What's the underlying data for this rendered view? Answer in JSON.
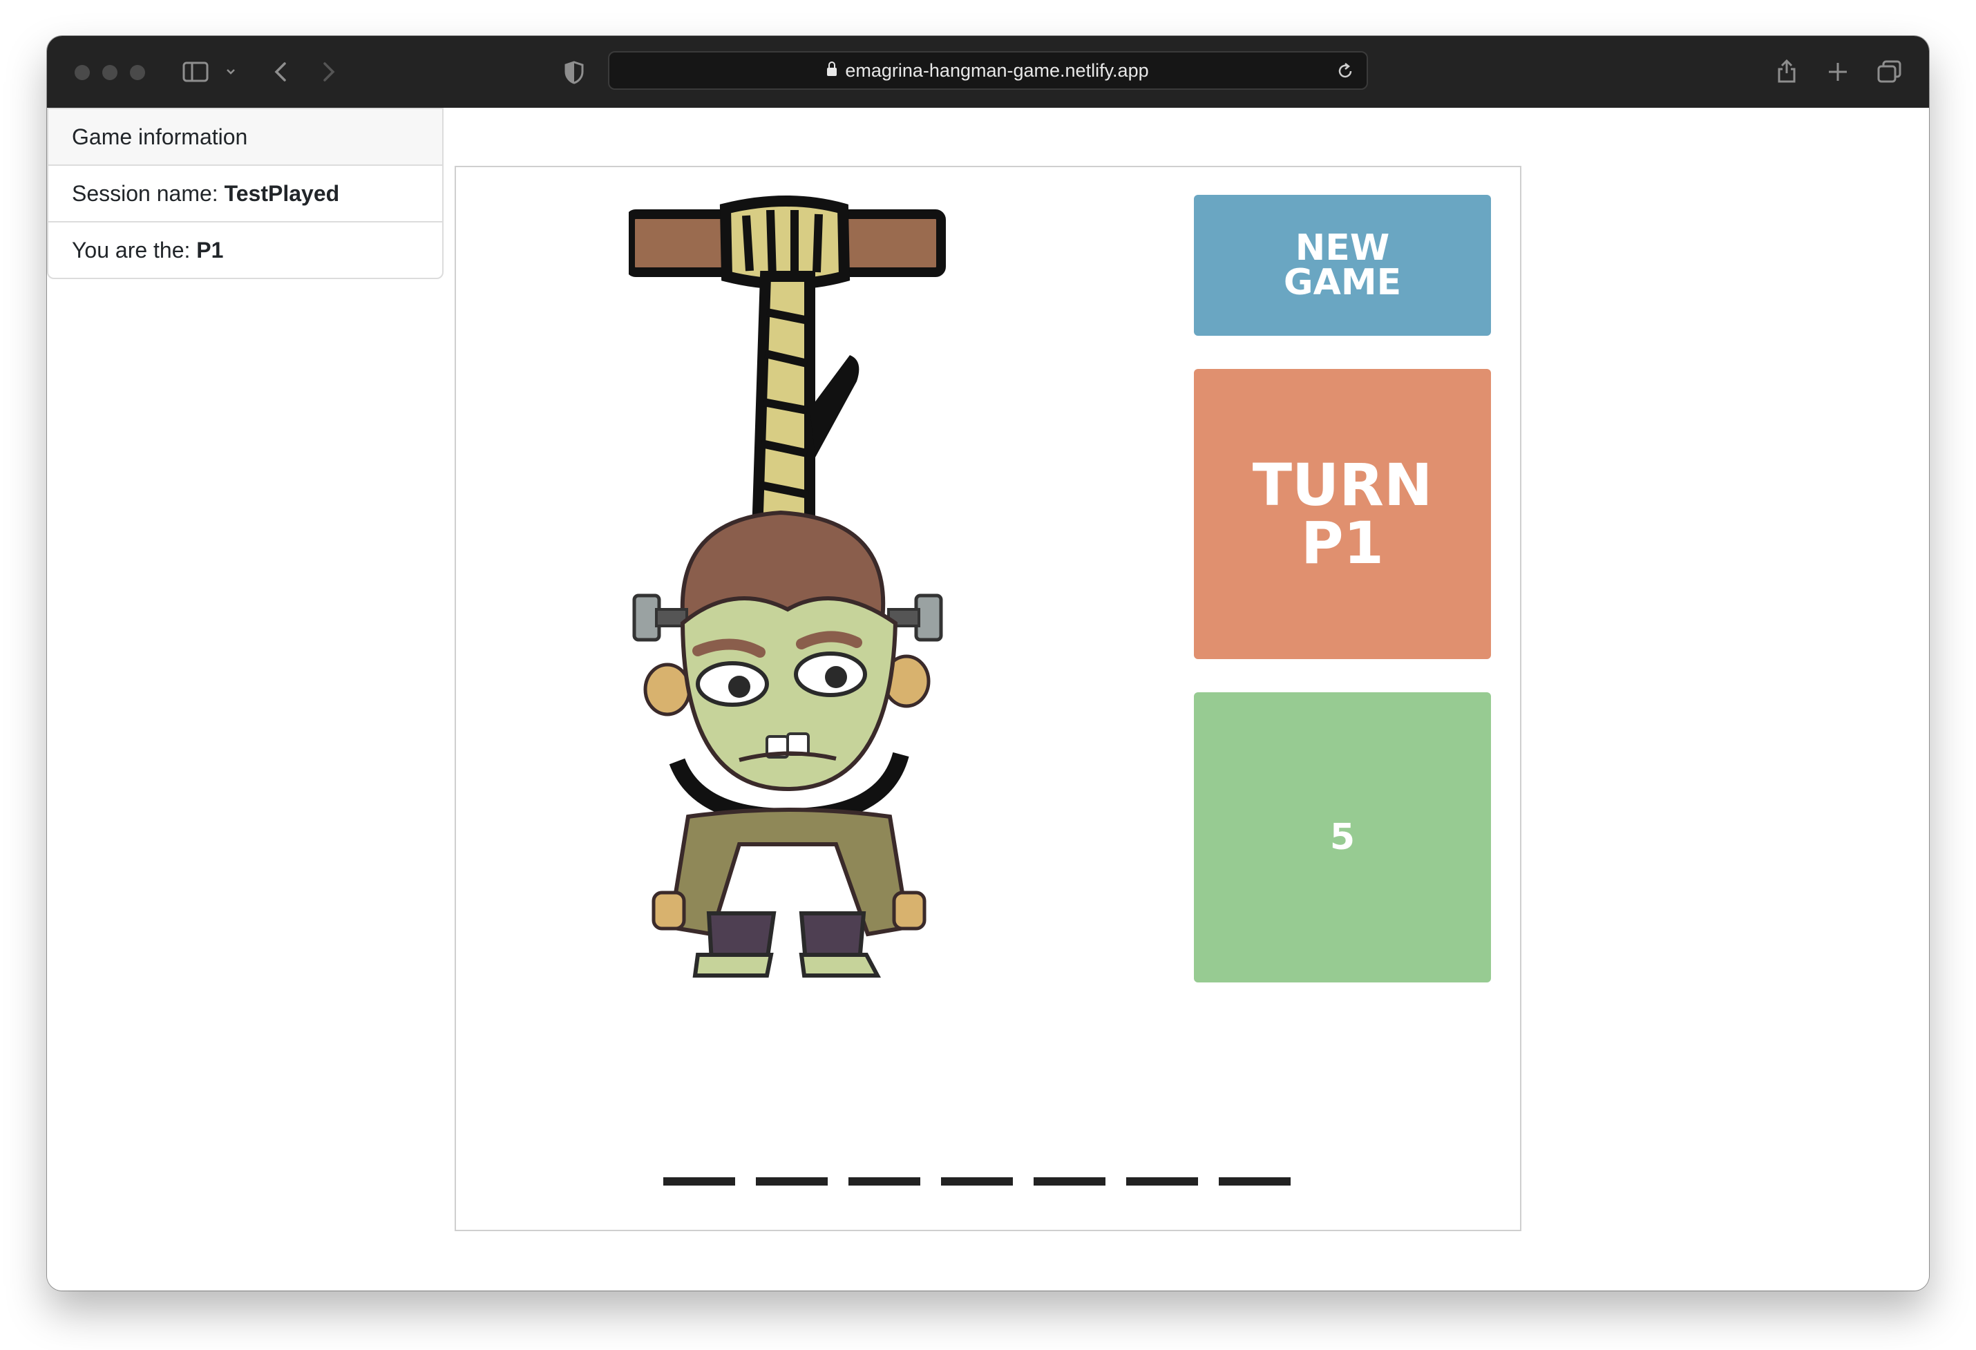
{
  "browser": {
    "url": "emagrina-hangman-game.netlify.app"
  },
  "sidebar": {
    "header": "Game information",
    "session_label": "Session name: ",
    "session_value": "TestPlayed",
    "role_label": "You are the: ",
    "role_value": "P1"
  },
  "game": {
    "new_game_label": "NEW\nGAME",
    "turn_label": "TURN\nP1",
    "counter_value": "5",
    "word_length": 7
  },
  "colors": {
    "new_game": "#6aa6c2",
    "turn": "#e0906f",
    "counter": "#97cb92"
  },
  "icons": [
    "sidebar-toggle-icon",
    "chevron-down-icon",
    "back-arrow-icon",
    "forward-arrow-icon",
    "shield-icon",
    "lock-icon",
    "reload-icon",
    "share-icon",
    "new-tab-icon",
    "tabs-overview-icon"
  ]
}
